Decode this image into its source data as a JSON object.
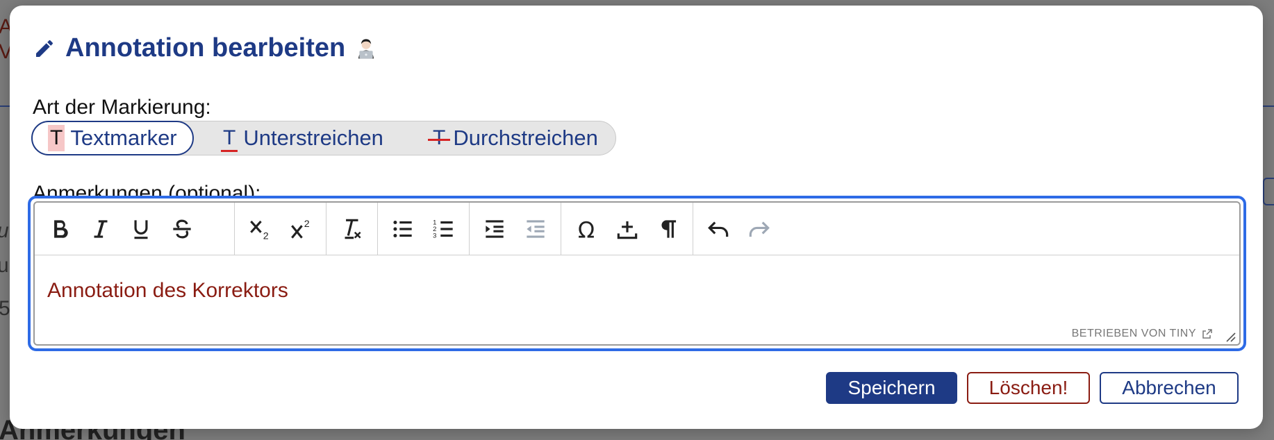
{
  "background": {
    "text_a": "A",
    "text_v": "V",
    "text_u1": "u",
    "text_u2": "u",
    "text_5": "5",
    "heading": "Anmerkungen"
  },
  "dialog": {
    "title": "Annotation bearbeiten",
    "mark_label": "Art der Markierung:",
    "mark_options": [
      {
        "glyph": "T",
        "label": "Textmarker",
        "selected": true
      },
      {
        "glyph": "T",
        "label": "Unterstreichen",
        "selected": false
      },
      {
        "glyph": "T",
        "label": "Durchstreichen",
        "selected": false
      }
    ],
    "notes_label": "Anmerkungen (optional):",
    "editor": {
      "content": "Annotation des Korrektors",
      "powered_by": "BETRIEBEN VON TINY"
    },
    "buttons": {
      "save": "Speichern",
      "delete": "Löschen!",
      "cancel": "Abbrechen"
    }
  },
  "colors": {
    "primary": "#1e3a85",
    "danger": "#8a1c12",
    "focus": "#2e6be6",
    "highlight": "#f6c7c7",
    "mark_red": "#d62424"
  }
}
